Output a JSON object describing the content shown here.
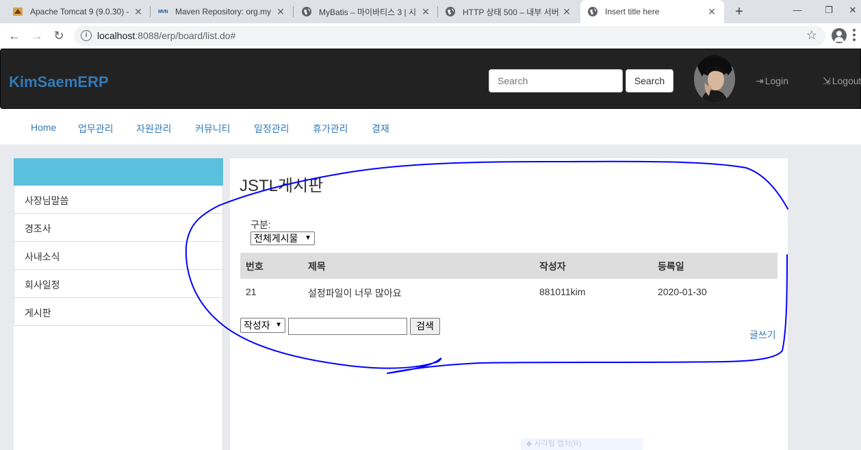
{
  "browser": {
    "tabs": [
      {
        "title": "Apache Tomcat 9 (9.0.30) -",
        "icon": "tomcat-icon",
        "active": false
      },
      {
        "title": "Maven Repository: org.my",
        "icon": "maven-icon",
        "favicon_text": "MVN",
        "active": false
      },
      {
        "title": "MyBatis – 마이바티스 3 | 시",
        "icon": "globe-icon",
        "active": false
      },
      {
        "title": "HTTP 상태 500 – 내부 서버",
        "icon": "globe-icon",
        "active": false
      },
      {
        "title": "Insert title here",
        "icon": "globe-icon",
        "active": true
      }
    ],
    "url_host": "localhost",
    "url_rest": ":8088/erp/board/list.do#"
  },
  "navbar": {
    "brand": "KimSaemERP",
    "search_placeholder": "Search",
    "search_button": "Search",
    "login": "Login",
    "logout": "Logout"
  },
  "menu": [
    "Home",
    "업무관리",
    "자원관리",
    "커뮤니티",
    "일정관리",
    "휴가관리",
    "결재"
  ],
  "sidebar": [
    "사장님말씀",
    "경조사",
    "사내소식",
    "회사일정",
    "게시판"
  ],
  "board": {
    "title": "JSTL게시판",
    "category_label": "구분:",
    "category_selected": "전체게시물",
    "columns": [
      "번호",
      "제목",
      "작성자",
      "등록일"
    ],
    "rows": [
      {
        "no": "21",
        "title": "설정파일이 너무 많아요",
        "writer": "881011kim",
        "date": "2020-01-30"
      }
    ],
    "search_field_selected": "작성자",
    "search_button": "검색",
    "write_link": "글쓰기"
  },
  "overlay": {
    "ghost_text": "사각형 캡처(R)",
    "annotation_color": "#0000ff"
  }
}
